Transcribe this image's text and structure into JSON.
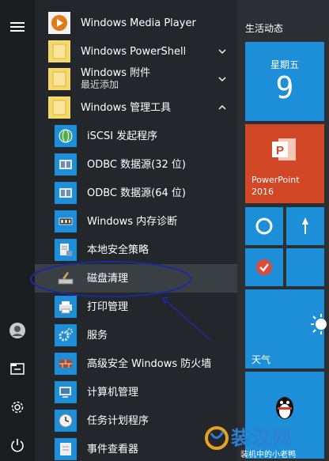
{
  "apps": [
    {
      "label": "Windows Media Player",
      "icon": "media-player-icon",
      "chev": ""
    },
    {
      "label": "Windows PowerShell",
      "icon": "folder-icon",
      "chev": "down"
    },
    {
      "label": "Windows 附件",
      "sub": "最近添加",
      "icon": "folder-icon",
      "chev": "down"
    },
    {
      "label": "Windows 管理工具",
      "icon": "folder-icon",
      "chev": "up"
    }
  ],
  "admin_tools": [
    {
      "label": "iSCSI 发起程序",
      "icon": "globe-icon"
    },
    {
      "label": "ODBC 数据源(32 位)",
      "icon": "database-icon"
    },
    {
      "label": "ODBC 数据源(64 位)",
      "icon": "database-icon"
    },
    {
      "label": "Windows 内存诊断",
      "icon": "memory-chip-icon"
    },
    {
      "label": "本地安全策略",
      "icon": "security-policy-icon"
    },
    {
      "label": "磁盘清理",
      "icon": "disk-cleanup-icon"
    },
    {
      "label": "打印管理",
      "icon": "printer-icon"
    },
    {
      "label": "服务",
      "icon": "gear-icon"
    },
    {
      "label": "高级安全 Windows 防火墙",
      "icon": "firewall-icon"
    },
    {
      "label": "计算机管理",
      "icon": "computer-management-icon"
    },
    {
      "label": "任务计划程序",
      "icon": "clock-icon"
    },
    {
      "label": "事件查看器",
      "icon": "event-viewer-icon"
    }
  ],
  "tiles": {
    "group_title": "生活动态",
    "calendar": {
      "weekday": "星期五",
      "day": "9"
    },
    "powerpoint": {
      "label1": "PowerPoint",
      "label2": "2016"
    },
    "weather": {
      "label": "天气"
    }
  },
  "watermark": {
    "brand": "装汉网",
    "sub": "装机中的小老鸭"
  },
  "colors": {
    "accent": "#1d8fd8",
    "powerpoint": "#d24726",
    "list_bg": "#23272b",
    "annotation": "#1a2ba0"
  }
}
